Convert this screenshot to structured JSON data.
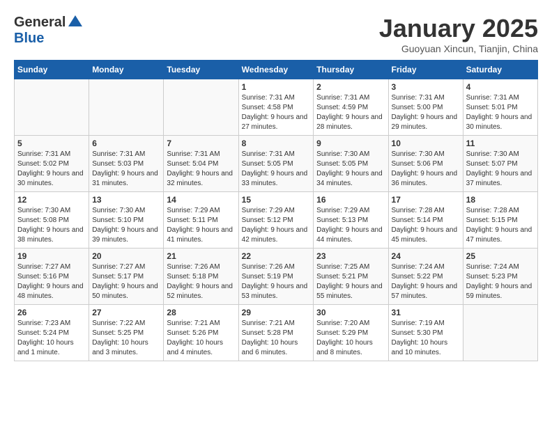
{
  "header": {
    "logo_general": "General",
    "logo_blue": "Blue",
    "month_title": "January 2025",
    "subtitle": "Guoyuan Xincun, Tianjin, China"
  },
  "days_of_week": [
    "Sunday",
    "Monday",
    "Tuesday",
    "Wednesday",
    "Thursday",
    "Friday",
    "Saturday"
  ],
  "weeks": [
    [
      {
        "day": "",
        "content": ""
      },
      {
        "day": "",
        "content": ""
      },
      {
        "day": "",
        "content": ""
      },
      {
        "day": "1",
        "content": "Sunrise: 7:31 AM\nSunset: 4:58 PM\nDaylight: 9 hours and 27 minutes."
      },
      {
        "day": "2",
        "content": "Sunrise: 7:31 AM\nSunset: 4:59 PM\nDaylight: 9 hours and 28 minutes."
      },
      {
        "day": "3",
        "content": "Sunrise: 7:31 AM\nSunset: 5:00 PM\nDaylight: 9 hours and 29 minutes."
      },
      {
        "day": "4",
        "content": "Sunrise: 7:31 AM\nSunset: 5:01 PM\nDaylight: 9 hours and 30 minutes."
      }
    ],
    [
      {
        "day": "5",
        "content": "Sunrise: 7:31 AM\nSunset: 5:02 PM\nDaylight: 9 hours and 30 minutes."
      },
      {
        "day": "6",
        "content": "Sunrise: 7:31 AM\nSunset: 5:03 PM\nDaylight: 9 hours and 31 minutes."
      },
      {
        "day": "7",
        "content": "Sunrise: 7:31 AM\nSunset: 5:04 PM\nDaylight: 9 hours and 32 minutes."
      },
      {
        "day": "8",
        "content": "Sunrise: 7:31 AM\nSunset: 5:05 PM\nDaylight: 9 hours and 33 minutes."
      },
      {
        "day": "9",
        "content": "Sunrise: 7:30 AM\nSunset: 5:05 PM\nDaylight: 9 hours and 34 minutes."
      },
      {
        "day": "10",
        "content": "Sunrise: 7:30 AM\nSunset: 5:06 PM\nDaylight: 9 hours and 36 minutes."
      },
      {
        "day": "11",
        "content": "Sunrise: 7:30 AM\nSunset: 5:07 PM\nDaylight: 9 hours and 37 minutes."
      }
    ],
    [
      {
        "day": "12",
        "content": "Sunrise: 7:30 AM\nSunset: 5:08 PM\nDaylight: 9 hours and 38 minutes."
      },
      {
        "day": "13",
        "content": "Sunrise: 7:30 AM\nSunset: 5:10 PM\nDaylight: 9 hours and 39 minutes."
      },
      {
        "day": "14",
        "content": "Sunrise: 7:29 AM\nSunset: 5:11 PM\nDaylight: 9 hours and 41 minutes."
      },
      {
        "day": "15",
        "content": "Sunrise: 7:29 AM\nSunset: 5:12 PM\nDaylight: 9 hours and 42 minutes."
      },
      {
        "day": "16",
        "content": "Sunrise: 7:29 AM\nSunset: 5:13 PM\nDaylight: 9 hours and 44 minutes."
      },
      {
        "day": "17",
        "content": "Sunrise: 7:28 AM\nSunset: 5:14 PM\nDaylight: 9 hours and 45 minutes."
      },
      {
        "day": "18",
        "content": "Sunrise: 7:28 AM\nSunset: 5:15 PM\nDaylight: 9 hours and 47 minutes."
      }
    ],
    [
      {
        "day": "19",
        "content": "Sunrise: 7:27 AM\nSunset: 5:16 PM\nDaylight: 9 hours and 48 minutes."
      },
      {
        "day": "20",
        "content": "Sunrise: 7:27 AM\nSunset: 5:17 PM\nDaylight: 9 hours and 50 minutes."
      },
      {
        "day": "21",
        "content": "Sunrise: 7:26 AM\nSunset: 5:18 PM\nDaylight: 9 hours and 52 minutes."
      },
      {
        "day": "22",
        "content": "Sunrise: 7:26 AM\nSunset: 5:19 PM\nDaylight: 9 hours and 53 minutes."
      },
      {
        "day": "23",
        "content": "Sunrise: 7:25 AM\nSunset: 5:21 PM\nDaylight: 9 hours and 55 minutes."
      },
      {
        "day": "24",
        "content": "Sunrise: 7:24 AM\nSunset: 5:22 PM\nDaylight: 9 hours and 57 minutes."
      },
      {
        "day": "25",
        "content": "Sunrise: 7:24 AM\nSunset: 5:23 PM\nDaylight: 9 hours and 59 minutes."
      }
    ],
    [
      {
        "day": "26",
        "content": "Sunrise: 7:23 AM\nSunset: 5:24 PM\nDaylight: 10 hours and 1 minute."
      },
      {
        "day": "27",
        "content": "Sunrise: 7:22 AM\nSunset: 5:25 PM\nDaylight: 10 hours and 3 minutes."
      },
      {
        "day": "28",
        "content": "Sunrise: 7:21 AM\nSunset: 5:26 PM\nDaylight: 10 hours and 4 minutes."
      },
      {
        "day": "29",
        "content": "Sunrise: 7:21 AM\nSunset: 5:28 PM\nDaylight: 10 hours and 6 minutes."
      },
      {
        "day": "30",
        "content": "Sunrise: 7:20 AM\nSunset: 5:29 PM\nDaylight: 10 hours and 8 minutes."
      },
      {
        "day": "31",
        "content": "Sunrise: 7:19 AM\nSunset: 5:30 PM\nDaylight: 10 hours and 10 minutes."
      },
      {
        "day": "",
        "content": ""
      }
    ]
  ]
}
